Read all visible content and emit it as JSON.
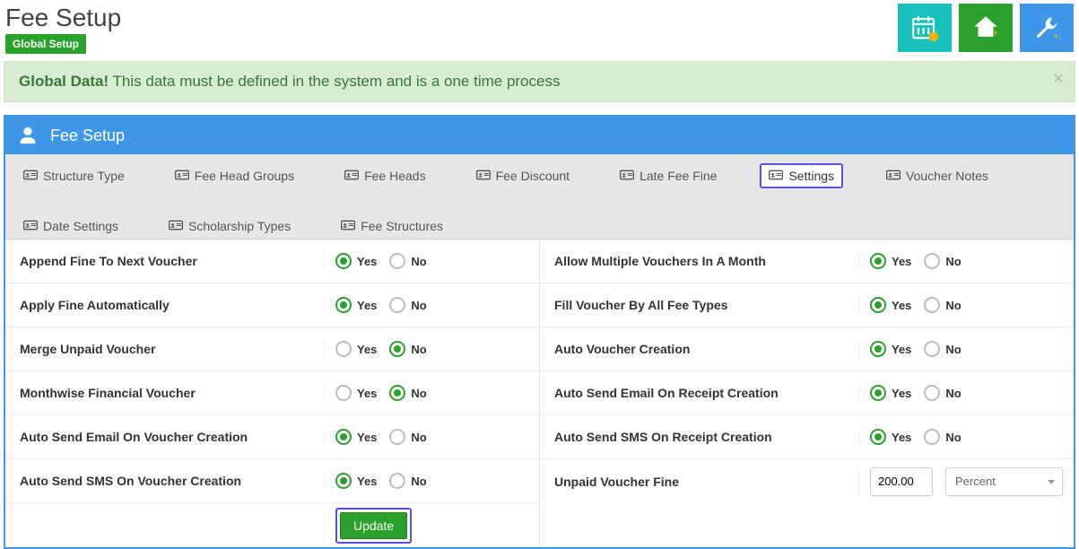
{
  "header": {
    "title": "Fee Setup",
    "badge": "Global Setup"
  },
  "alert": {
    "strong": "Global Data!",
    "text": " This data must be defined in the system and is a one time process"
  },
  "panel": {
    "title": "Fee Setup"
  },
  "tabs": [
    {
      "label": "Structure Type",
      "active": false
    },
    {
      "label": "Fee Head Groups",
      "active": false
    },
    {
      "label": "Fee Heads",
      "active": false
    },
    {
      "label": "Fee Discount",
      "active": false
    },
    {
      "label": "Late Fee Fine",
      "active": false
    },
    {
      "label": "Settings",
      "active": true
    },
    {
      "label": "Voucher Notes",
      "active": false
    },
    {
      "label": "Date Settings",
      "active": false
    },
    {
      "label": "Scholarship Types",
      "active": false
    },
    {
      "label": "Fee Structures",
      "active": false
    }
  ],
  "radio": {
    "yes": "Yes",
    "no": "No"
  },
  "left": [
    {
      "label": "Append Fine To Next Voucher",
      "value": "yes"
    },
    {
      "label": "Apply Fine Automatically",
      "value": "yes"
    },
    {
      "label": "Merge Unpaid Voucher",
      "value": "no"
    },
    {
      "label": "Monthwise Financial Voucher",
      "value": "no"
    },
    {
      "label": "Auto Send Email On Voucher Creation",
      "value": "yes"
    },
    {
      "label": "Auto Send SMS On Voucher Creation",
      "value": "yes"
    }
  ],
  "right": [
    {
      "label": "Allow Multiple Vouchers In A Month",
      "value": "yes"
    },
    {
      "label": "Fill Voucher By All Fee Types",
      "value": "yes"
    },
    {
      "label": "Auto Voucher Creation",
      "value": "yes"
    },
    {
      "label": "Auto Send Email On Receipt Creation",
      "value": "yes"
    },
    {
      "label": "Auto Send SMS On Receipt Creation",
      "value": "yes"
    }
  ],
  "unpaid": {
    "label": "Unpaid Voucher Fine",
    "amount": "200.00",
    "unit": "Percent"
  },
  "buttons": {
    "update": "Update"
  }
}
